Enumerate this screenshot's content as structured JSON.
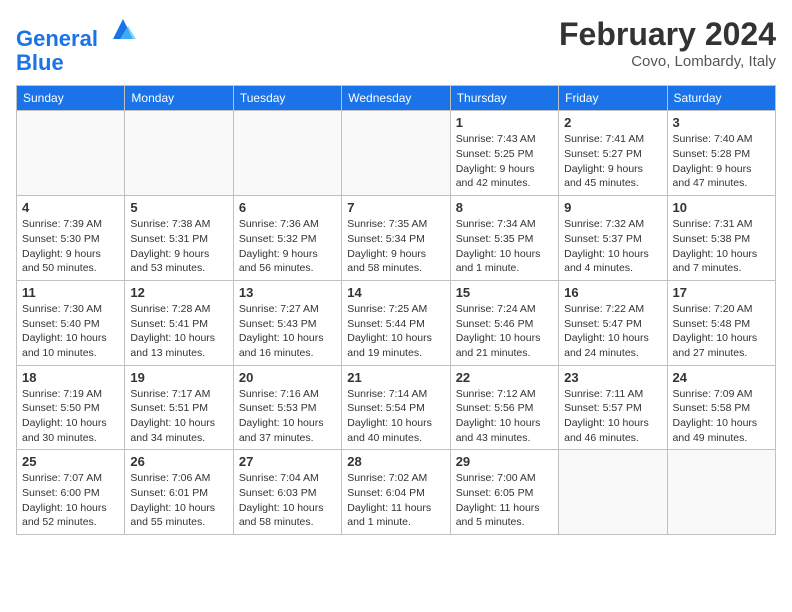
{
  "header": {
    "logo_line1": "General",
    "logo_line2": "Blue",
    "month_year": "February 2024",
    "location": "Covo, Lombardy, Italy"
  },
  "days_of_week": [
    "Sunday",
    "Monday",
    "Tuesday",
    "Wednesday",
    "Thursday",
    "Friday",
    "Saturday"
  ],
  "weeks": [
    [
      {
        "day": "",
        "info": ""
      },
      {
        "day": "",
        "info": ""
      },
      {
        "day": "",
        "info": ""
      },
      {
        "day": "",
        "info": ""
      },
      {
        "day": "1",
        "info": "Sunrise: 7:43 AM\nSunset: 5:25 PM\nDaylight: 9 hours\nand 42 minutes."
      },
      {
        "day": "2",
        "info": "Sunrise: 7:41 AM\nSunset: 5:27 PM\nDaylight: 9 hours\nand 45 minutes."
      },
      {
        "day": "3",
        "info": "Sunrise: 7:40 AM\nSunset: 5:28 PM\nDaylight: 9 hours\nand 47 minutes."
      }
    ],
    [
      {
        "day": "4",
        "info": "Sunrise: 7:39 AM\nSunset: 5:30 PM\nDaylight: 9 hours\nand 50 minutes."
      },
      {
        "day": "5",
        "info": "Sunrise: 7:38 AM\nSunset: 5:31 PM\nDaylight: 9 hours\nand 53 minutes."
      },
      {
        "day": "6",
        "info": "Sunrise: 7:36 AM\nSunset: 5:32 PM\nDaylight: 9 hours\nand 56 minutes."
      },
      {
        "day": "7",
        "info": "Sunrise: 7:35 AM\nSunset: 5:34 PM\nDaylight: 9 hours\nand 58 minutes."
      },
      {
        "day": "8",
        "info": "Sunrise: 7:34 AM\nSunset: 5:35 PM\nDaylight: 10 hours\nand 1 minute."
      },
      {
        "day": "9",
        "info": "Sunrise: 7:32 AM\nSunset: 5:37 PM\nDaylight: 10 hours\nand 4 minutes."
      },
      {
        "day": "10",
        "info": "Sunrise: 7:31 AM\nSunset: 5:38 PM\nDaylight: 10 hours\nand 7 minutes."
      }
    ],
    [
      {
        "day": "11",
        "info": "Sunrise: 7:30 AM\nSunset: 5:40 PM\nDaylight: 10 hours\nand 10 minutes."
      },
      {
        "day": "12",
        "info": "Sunrise: 7:28 AM\nSunset: 5:41 PM\nDaylight: 10 hours\nand 13 minutes."
      },
      {
        "day": "13",
        "info": "Sunrise: 7:27 AM\nSunset: 5:43 PM\nDaylight: 10 hours\nand 16 minutes."
      },
      {
        "day": "14",
        "info": "Sunrise: 7:25 AM\nSunset: 5:44 PM\nDaylight: 10 hours\nand 19 minutes."
      },
      {
        "day": "15",
        "info": "Sunrise: 7:24 AM\nSunset: 5:46 PM\nDaylight: 10 hours\nand 21 minutes."
      },
      {
        "day": "16",
        "info": "Sunrise: 7:22 AM\nSunset: 5:47 PM\nDaylight: 10 hours\nand 24 minutes."
      },
      {
        "day": "17",
        "info": "Sunrise: 7:20 AM\nSunset: 5:48 PM\nDaylight: 10 hours\nand 27 minutes."
      }
    ],
    [
      {
        "day": "18",
        "info": "Sunrise: 7:19 AM\nSunset: 5:50 PM\nDaylight: 10 hours\nand 30 minutes."
      },
      {
        "day": "19",
        "info": "Sunrise: 7:17 AM\nSunset: 5:51 PM\nDaylight: 10 hours\nand 34 minutes."
      },
      {
        "day": "20",
        "info": "Sunrise: 7:16 AM\nSunset: 5:53 PM\nDaylight: 10 hours\nand 37 minutes."
      },
      {
        "day": "21",
        "info": "Sunrise: 7:14 AM\nSunset: 5:54 PM\nDaylight: 10 hours\nand 40 minutes."
      },
      {
        "day": "22",
        "info": "Sunrise: 7:12 AM\nSunset: 5:56 PM\nDaylight: 10 hours\nand 43 minutes."
      },
      {
        "day": "23",
        "info": "Sunrise: 7:11 AM\nSunset: 5:57 PM\nDaylight: 10 hours\nand 46 minutes."
      },
      {
        "day": "24",
        "info": "Sunrise: 7:09 AM\nSunset: 5:58 PM\nDaylight: 10 hours\nand 49 minutes."
      }
    ],
    [
      {
        "day": "25",
        "info": "Sunrise: 7:07 AM\nSunset: 6:00 PM\nDaylight: 10 hours\nand 52 minutes."
      },
      {
        "day": "26",
        "info": "Sunrise: 7:06 AM\nSunset: 6:01 PM\nDaylight: 10 hours\nand 55 minutes."
      },
      {
        "day": "27",
        "info": "Sunrise: 7:04 AM\nSunset: 6:03 PM\nDaylight: 10 hours\nand 58 minutes."
      },
      {
        "day": "28",
        "info": "Sunrise: 7:02 AM\nSunset: 6:04 PM\nDaylight: 11 hours\nand 1 minute."
      },
      {
        "day": "29",
        "info": "Sunrise: 7:00 AM\nSunset: 6:05 PM\nDaylight: 11 hours\nand 5 minutes."
      },
      {
        "day": "",
        "info": ""
      },
      {
        "day": "",
        "info": ""
      }
    ]
  ]
}
